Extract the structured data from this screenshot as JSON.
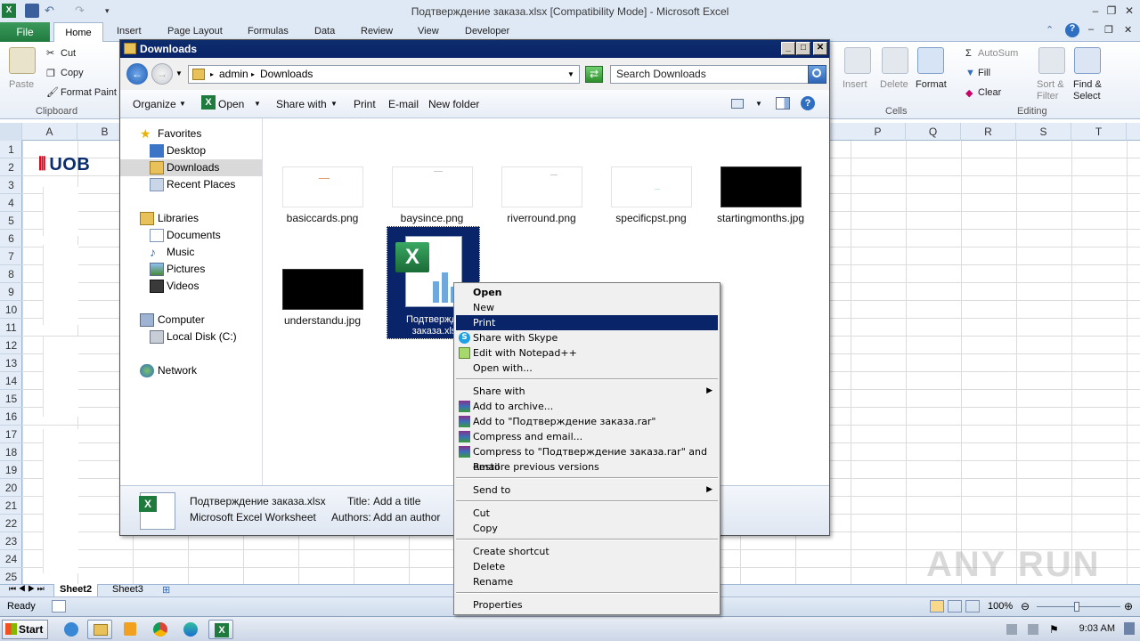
{
  "excel": {
    "title": "Подтверждение заказа.xlsx  [Compatibility Mode]  -  Microsoft Excel",
    "tabs": [
      "Insert",
      "Page Layout",
      "Formulas",
      "Data",
      "Review",
      "View",
      "Developer"
    ],
    "file_tab": "File",
    "home_tab": "Home",
    "clipboard": {
      "paste": "Paste",
      "cut": "Cut",
      "copy": "Copy",
      "format_painter": "Format Paint",
      "group": "Clipboard"
    },
    "cells_group": {
      "insert": "Insert",
      "delete": "Delete",
      "format": "Format",
      "group": "Cells"
    },
    "editing_group": {
      "autosum": "AutoSum",
      "fill": "Fill",
      "clear": "Clear",
      "sort_filter_1": "Sort &",
      "sort_filter_2": "Filter",
      "find_select_1": "Find &",
      "find_select_2": "Select",
      "group": "Editing"
    },
    "columns_left": [
      "A",
      "B"
    ],
    "columns_right": [
      "P",
      "Q",
      "R",
      "S",
      "T"
    ],
    "rows": [
      "1",
      "2",
      "3",
      "4",
      "5",
      "6",
      "7",
      "8",
      "9",
      "10",
      "11",
      "12",
      "13",
      "14",
      "15",
      "16",
      "17",
      "18",
      "19",
      "20",
      "21",
      "22",
      "23",
      "24",
      "25"
    ],
    "logo_text": "UOB",
    "sheets": [
      "Sheet2",
      "Sheet3"
    ],
    "status": "Ready",
    "zoom": "100%"
  },
  "explorer": {
    "title": "Downloads",
    "breadcrumb": [
      "admin",
      "Downloads"
    ],
    "search_placeholder": "Search Downloads",
    "toolbar": {
      "organize": "Organize",
      "open": "Open",
      "share_with": "Share with",
      "print": "Print",
      "email": "E-mail",
      "new_folder": "New folder"
    },
    "nav": {
      "favorites": "Favorites",
      "desktop": "Desktop",
      "downloads": "Downloads",
      "recent": "Recent Places",
      "libraries": "Libraries",
      "documents": "Documents",
      "music": "Music",
      "pictures": "Pictures",
      "videos": "Videos",
      "computer": "Computer",
      "local_disk": "Local Disk (C:)",
      "network": "Network"
    },
    "files": [
      "basiccards.png",
      "baysince.png",
      "riverround.png",
      "specificpst.png",
      "startingmonths.jpg",
      "understandu.jpg"
    ],
    "selected_file_line1": "Подтвержде",
    "selected_file_line2": "заказа.xls",
    "details": {
      "name": "Подтверждение заказа.xlsx",
      "type": "Microsoft Excel Worksheet",
      "title_label": "Title:",
      "title_value": "Add a title",
      "authors_label": "Authors:",
      "authors_value": "Add an author"
    }
  },
  "context_menu": {
    "open": "Open",
    "new": "New",
    "print": "Print",
    "share_skype": "Share with Skype",
    "edit_notepad": "Edit with Notepad++",
    "open_with": "Open with...",
    "share_with": "Share with",
    "add_archive": "Add to archive...",
    "add_rar": "Add to \"Подтверждение заказа.rar\"",
    "compress_email": "Compress and email...",
    "compress_rar_email": "Compress to \"Подтверждение заказа.rar\" and email",
    "restore": "Restore previous versions",
    "send_to": "Send to",
    "cut": "Cut",
    "copy": "Copy",
    "create_shortcut": "Create shortcut",
    "delete": "Delete",
    "rename": "Rename",
    "properties": "Properties"
  },
  "taskbar": {
    "start": "Start",
    "clock": "9:03 AM"
  },
  "watermark": "ANY RUN"
}
